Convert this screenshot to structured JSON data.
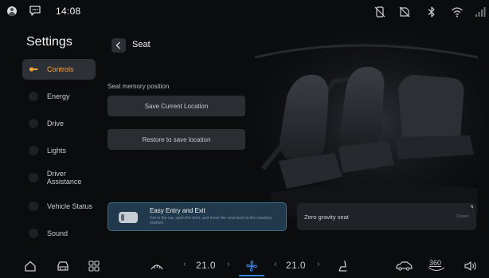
{
  "status_bar": {
    "time": "14:08",
    "left_icons": [
      "avatar-icon",
      "message-icon"
    ],
    "right_icons": [
      "no-phone-icon",
      "no-sim-icon",
      "bluetooth-icon",
      "wifi-icon",
      "signal-icon"
    ]
  },
  "sidebar": {
    "title": "Settings",
    "items": [
      {
        "label": "Controls",
        "icon": "key-icon",
        "active": true
      },
      {
        "label": "Energy",
        "icon": "energy-icon",
        "active": false
      },
      {
        "label": "Drive",
        "icon": "drive-icon",
        "active": false
      },
      {
        "label": "Lights",
        "icon": "lights-icon",
        "active": false
      },
      {
        "label": "Driver Assistance",
        "icon": "driver-assistance-icon",
        "active": false
      },
      {
        "label": "Vehicle Status",
        "icon": "vehicle-status-icon",
        "active": false
      },
      {
        "label": "Sound",
        "icon": "sound-icon",
        "active": false
      }
    ]
  },
  "page": {
    "title": "Seat",
    "section_label": "Seat memory position",
    "save_button": "Save Current Location",
    "restore_button": "Restore to save location"
  },
  "easy_entry": {
    "title": "Easy Entry and Exit",
    "description": "Get in the car, open the door, and move the seat back to the courtesy position",
    "enabled": true
  },
  "zero_gravity": {
    "title": "Zero gravity seat",
    "status": "Closed"
  },
  "dock": {
    "left_temp": "21.0",
    "right_temp": "21.0",
    "icons": [
      "home-icon",
      "car-icon",
      "apps-grid-icon",
      "defrost-icon",
      "fan-icon",
      "seat-icon",
      "car-side-icon",
      "360-view-icon",
      "volume-icon"
    ],
    "view_label": "360"
  },
  "colors": {
    "accent_orange": "#f6a23c",
    "accent_blue": "#3a86e8",
    "card_blue": "#21394c"
  }
}
